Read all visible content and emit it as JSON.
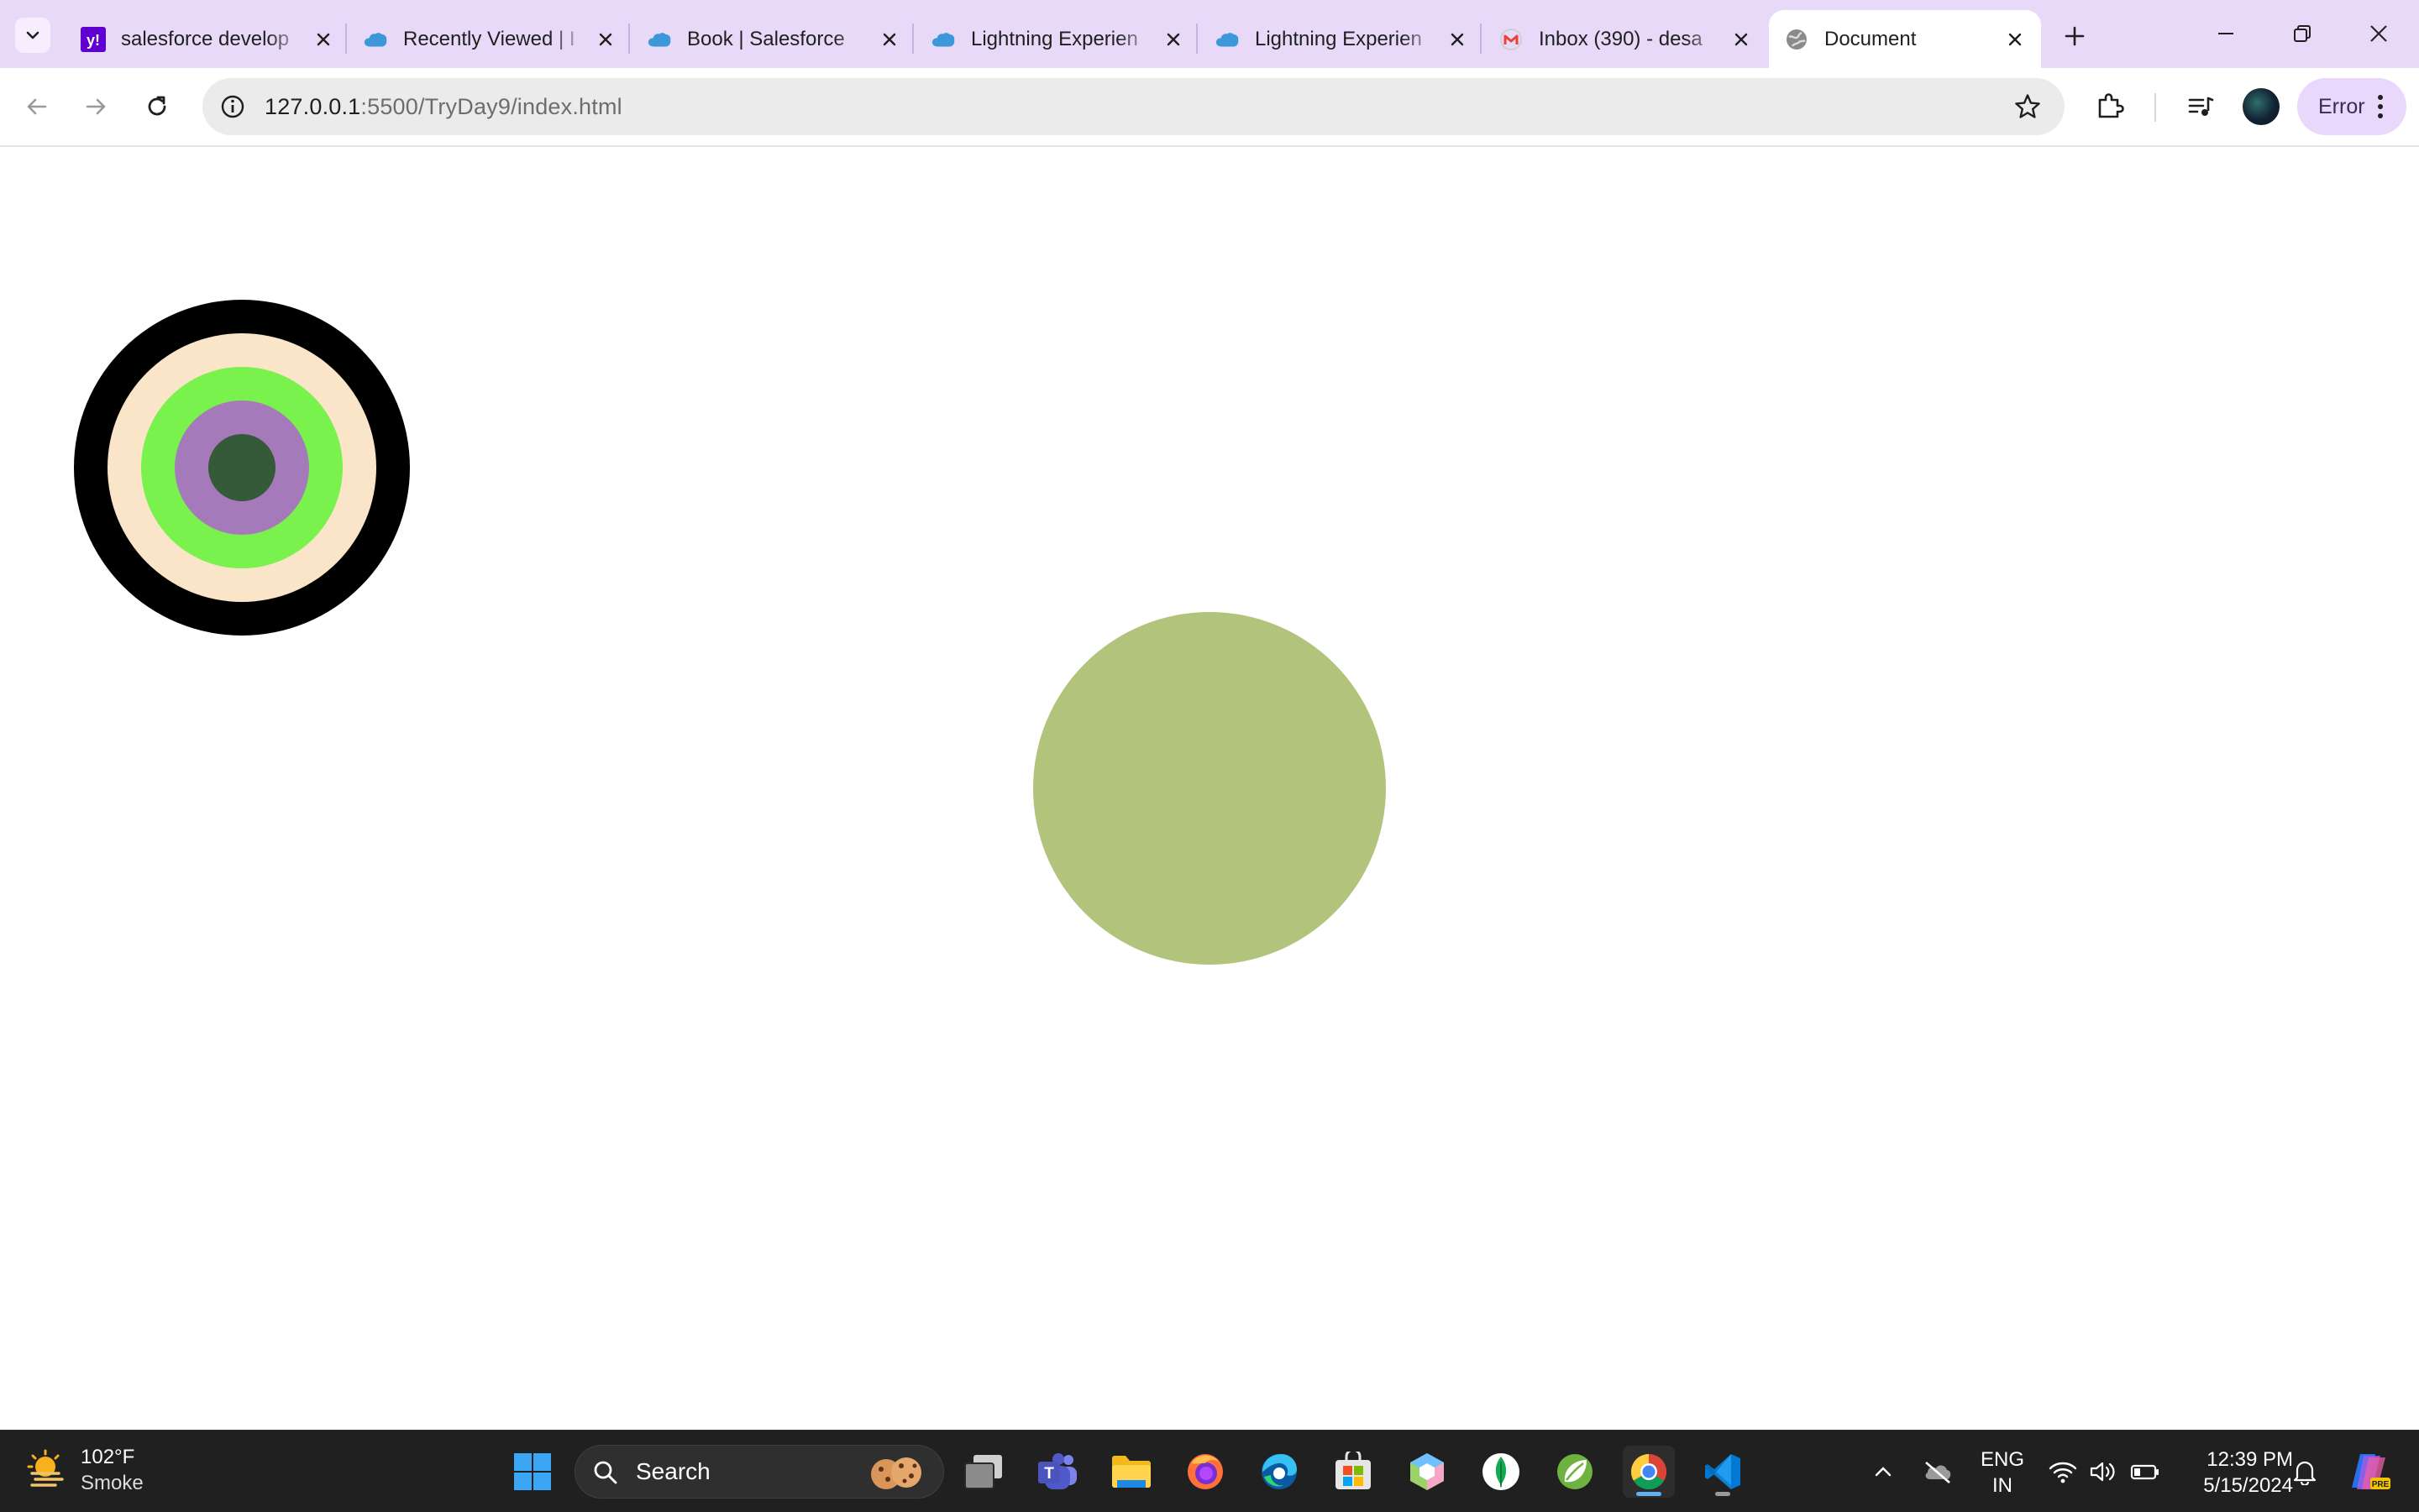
{
  "browser": {
    "tabs": [
      {
        "title": "salesforce develop",
        "favicon": "yahoo-icon",
        "active": false
      },
      {
        "title": "Recently Viewed | I",
        "favicon": "salesforce-cloud-icon",
        "active": false
      },
      {
        "title": "Book | Salesforce",
        "favicon": "salesforce-cloud-icon",
        "active": false
      },
      {
        "title": "Lightning Experien",
        "favicon": "salesforce-cloud-icon",
        "active": false
      },
      {
        "title": "Lightning Experien",
        "favicon": "salesforce-cloud-icon",
        "active": false
      },
      {
        "title": "Inbox (390) - desa",
        "favicon": "gmail-icon",
        "active": false
      },
      {
        "title": "Document",
        "favicon": "globe-icon",
        "active": true
      }
    ],
    "address": {
      "host": "127.0.0.1",
      "rest": ":5500/TryDay9/index.html"
    },
    "profile_status": "Error"
  },
  "page": {
    "target": {
      "ring_colors": [
        "#000000",
        "#fae5c8",
        "#7af24e",
        "#a57abb",
        "#355a38"
      ]
    },
    "ball_color": "#b2c37c"
  },
  "taskbar": {
    "weather": {
      "temp": "102°F",
      "condition": "Smoke"
    },
    "search_placeholder": "Search",
    "apps": [
      "task-view",
      "teams",
      "file-explorer",
      "firefox",
      "edge",
      "microsoft-store",
      "app-hexagon",
      "mongodb-compass",
      "spring-tool-suite",
      "chrome",
      "vscode"
    ],
    "language": {
      "line1": "ENG",
      "line2": "IN"
    },
    "clock": {
      "time": "12:39 PM",
      "date": "5/15/2024"
    }
  }
}
